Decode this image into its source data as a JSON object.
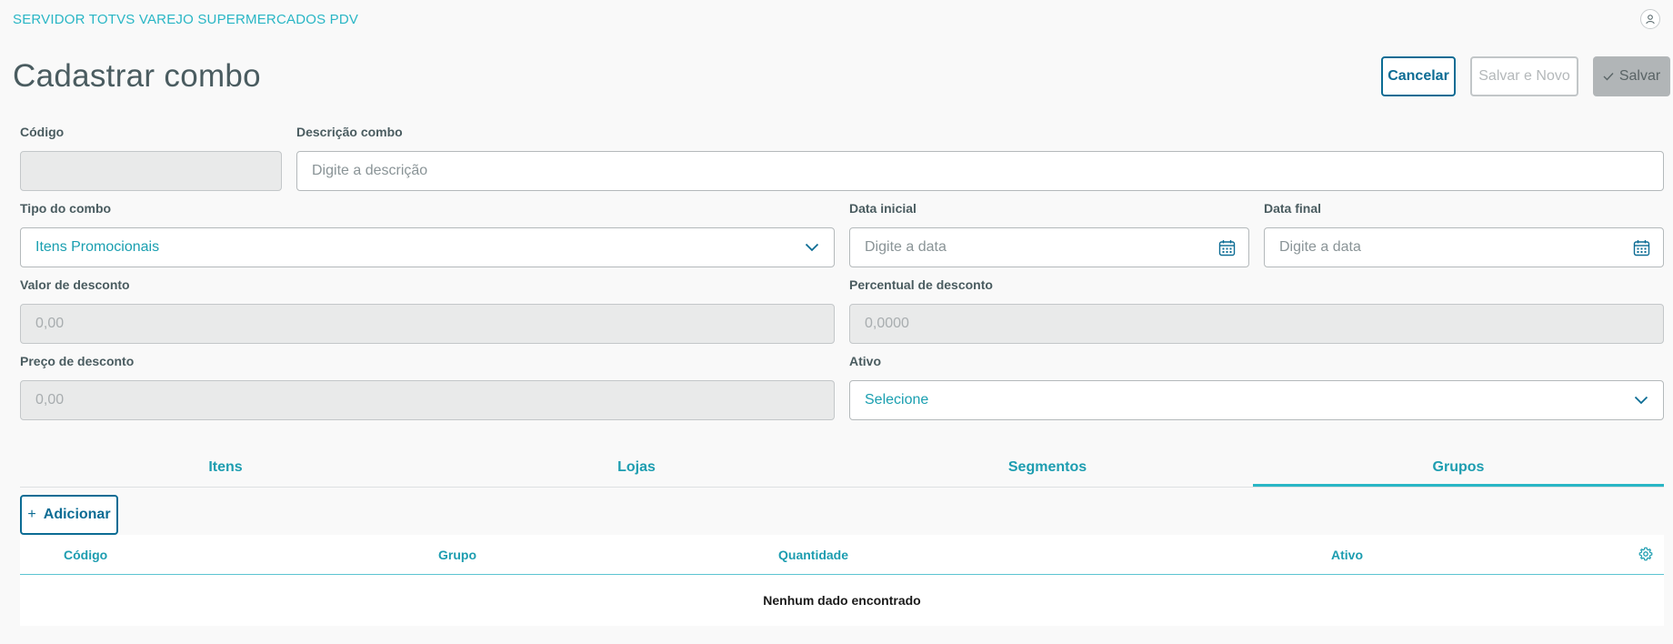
{
  "header": {
    "app_title": "SERVIDOR TOTVS VAREJO SUPERMERCADOS PDV"
  },
  "page": {
    "title": "Cadastrar combo"
  },
  "actions": {
    "cancel": "Cancelar",
    "save_new": "Salvar e Novo",
    "save": "Salvar"
  },
  "form": {
    "codigo": {
      "label": "Código",
      "value": ""
    },
    "descricao": {
      "label": "Descrição combo",
      "placeholder": "Digite a descrição"
    },
    "tipo": {
      "label": "Tipo do combo",
      "value": "Itens Promocionais"
    },
    "data_inicial": {
      "label": "Data inicial",
      "placeholder": "Digite a data"
    },
    "data_final": {
      "label": "Data final",
      "placeholder": "Digite a data"
    },
    "valor_desconto": {
      "label": "Valor de desconto",
      "value": "0,00"
    },
    "percentual_desconto": {
      "label": "Percentual de desconto",
      "value": "0,0000"
    },
    "preco_desconto": {
      "label": "Preço de desconto",
      "value": "0,00"
    },
    "ativo": {
      "label": "Ativo",
      "value": "Selecione"
    }
  },
  "tabs": [
    {
      "label": "Itens",
      "active": false
    },
    {
      "label": "Lojas",
      "active": false
    },
    {
      "label": "Segmentos",
      "active": false
    },
    {
      "label": "Grupos",
      "active": true
    }
  ],
  "grid": {
    "add_label": "Adicionar",
    "columns": [
      "Código",
      "Grupo",
      "Quantidade",
      "Ativo"
    ],
    "empty_text": "Nenhum dado encontrado"
  },
  "colors": {
    "primary": "#0c6c94",
    "accent": "#29b6c5",
    "link": "#1d9db0"
  }
}
